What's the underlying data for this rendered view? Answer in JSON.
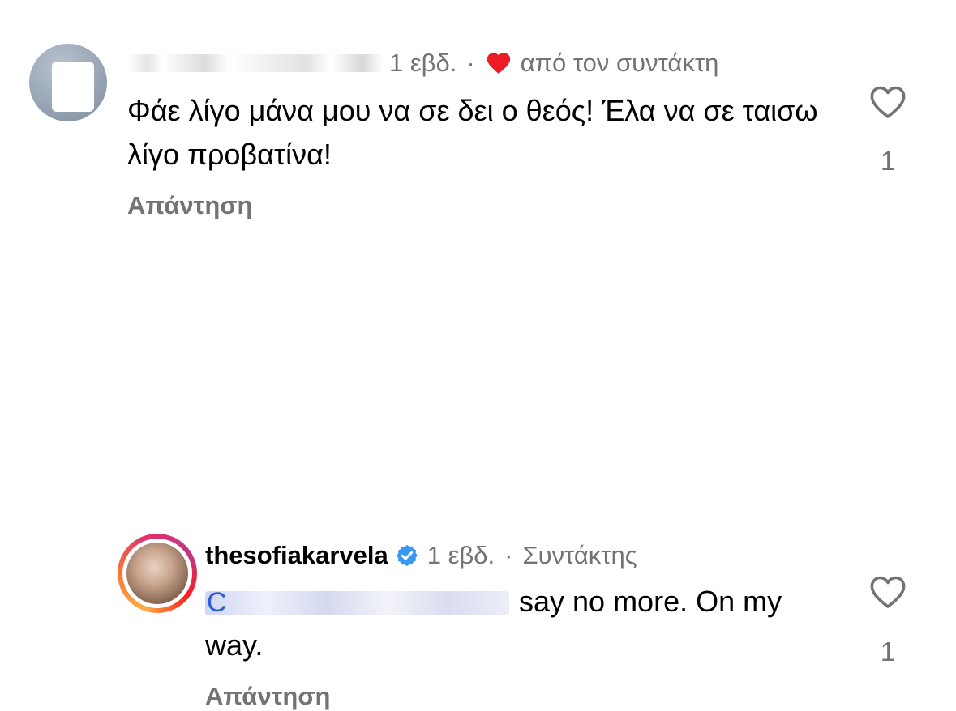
{
  "comments": [
    {
      "username_visible": false,
      "time": "1 εβδ.",
      "separator": "·",
      "author_badge": "από τον συντάκτη",
      "text": "Φάε λίγο μάνα μου να σε δει ο θεός! Έλα να σε ταισω λίγο προβατίνα!",
      "reply_label": "Απάντηση",
      "likes": "1",
      "liked_by_author": true
    },
    {
      "username": "thesofiakarvela",
      "verified": true,
      "time": "1 εβδ.",
      "separator": "·",
      "role": "Συντάκτης",
      "mention_visible": false,
      "text": "say no more. On my way.",
      "reply_label": "Απάντηση",
      "likes": "1"
    }
  ],
  "colors": {
    "secondary_text": "#737373",
    "heart_red": "#ed1c24",
    "verified_blue": "#3897f0",
    "mention_blue": "#2b5bd7"
  },
  "icons": {
    "like": "heart-outline-icon",
    "author_like": "heart-filled-icon",
    "verified": "verified-badge-icon"
  }
}
